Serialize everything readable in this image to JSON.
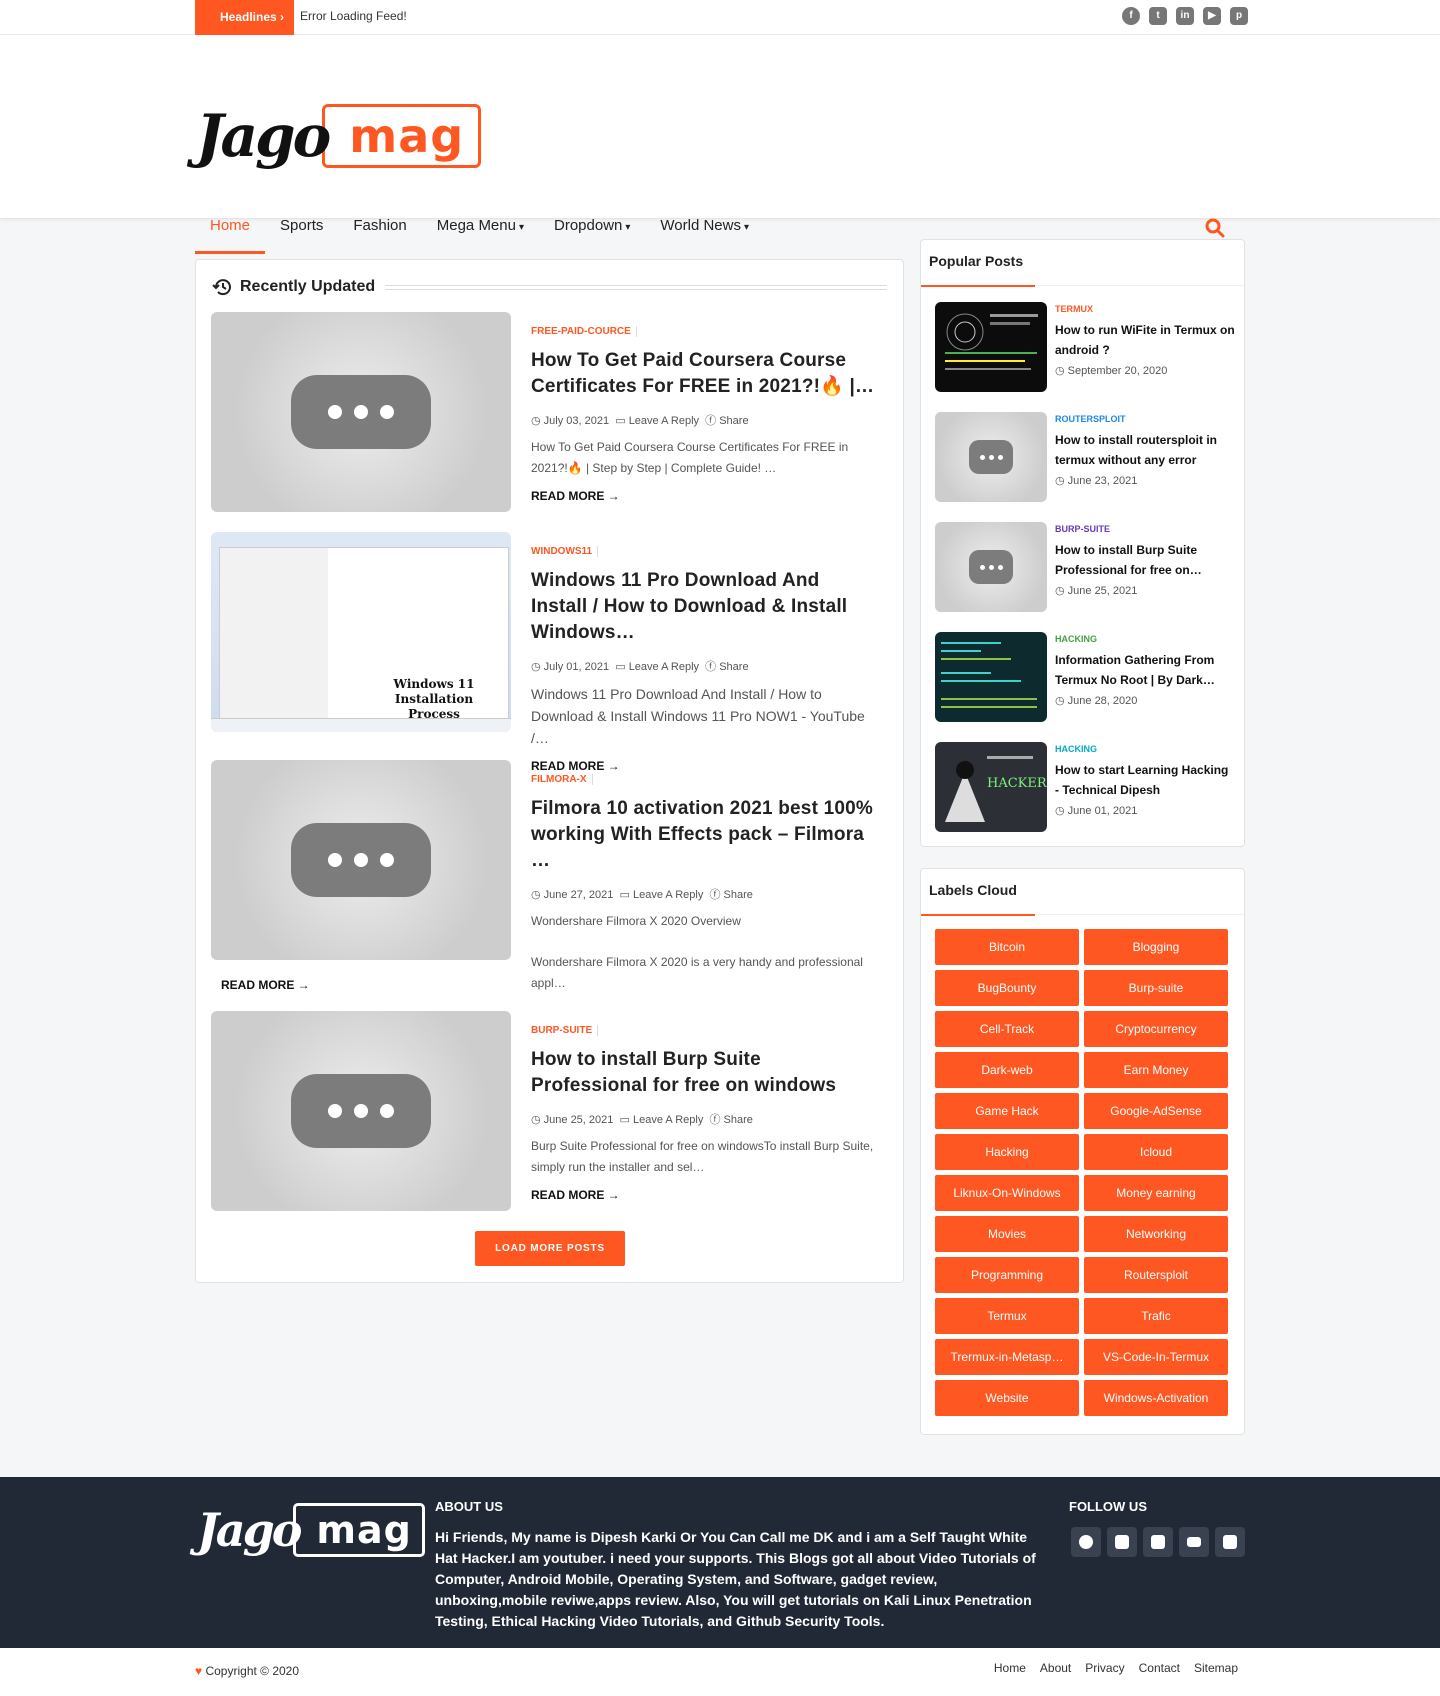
{
  "topbar": {
    "headlines_label": "Headlines",
    "ticker_text": "Error Loading Feed!",
    "social_icons": [
      "facebook-icon",
      "twitter-icon",
      "linkedin-icon",
      "youtube-icon",
      "pinterest-icon"
    ]
  },
  "brand": {
    "logo_part1": "Jago",
    "logo_part2": "mag",
    "accent": "#fe5722"
  },
  "nav": {
    "items": [
      {
        "label": "Home",
        "active": true,
        "dropdown": false
      },
      {
        "label": "Sports",
        "active": false,
        "dropdown": false
      },
      {
        "label": "Fashion",
        "active": false,
        "dropdown": false
      },
      {
        "label": "Mega Menu",
        "active": false,
        "dropdown": true
      },
      {
        "label": "Dropdown",
        "active": false,
        "dropdown": true
      },
      {
        "label": "World News",
        "active": false,
        "dropdown": true
      }
    ],
    "caret": "❯"
  },
  "main": {
    "section_title": "Recently Updated",
    "posts": [
      {
        "category": "FREE-PAID-COURCE",
        "title": "How To Get Paid Coursera Course Certificates For FREE in 2021?!🔥 |…",
        "date": "July 03, 2021",
        "reply": "Leave A Reply",
        "share": "Share",
        "excerpt": "How To Get Paid Coursera Course Certificates For FREE in 2021?!🔥 | Step by Step | Complete Guide! …",
        "read_more": "READ MORE"
      },
      {
        "category": "WINDOWS11",
        "title": "Windows 11 Pro Download And Install / How to Download & Install Windows…",
        "date": "July 01, 2021",
        "reply": "Leave A Reply",
        "share": "Share",
        "excerpt": "Windows 11 Pro Download And Install / How to Download & Install Windows 11 Pro NOW1 - YouTube /…",
        "read_more": "READ MORE",
        "thumb_text": "Windows 11 Installation Process"
      },
      {
        "category": "FILMORA-X",
        "title": "Filmora 10 activation 2021 best 100% working With Effects pack – Filmora …",
        "date": "June 27, 2021",
        "reply": "Leave A Reply",
        "share": "Share",
        "excerpt": "Wondershare Filmora X 2020 Overview",
        "excerpt2": "Wondershare Filmora X 2020 is a very handy and professional appl…",
        "read_more": "READ MORE"
      },
      {
        "category": "BURP-SUITE",
        "title": "How to install Burp Suite Professional for free on windows",
        "date": "June 25, 2021",
        "reply": "Leave A Reply",
        "share": "Share",
        "excerpt": "Burp Suite Professional for free on windowsTo install Burp Suite, simply run the installer and sel…",
        "read_more": "READ MORE"
      }
    ],
    "load_more": "LOAD MORE POSTS"
  },
  "popular": {
    "title": "Popular Posts",
    "items": [
      {
        "category": "TERMUX",
        "color": "#fe5722",
        "title": "How to run WiFite in Termux on android ?",
        "date": "September 20, 2020"
      },
      {
        "category": "ROUTERSPLOIT",
        "color": "#1e88e5",
        "title": "How to install routersploit in termux without any error",
        "date": "June 23, 2021"
      },
      {
        "category": "BURP-SUITE",
        "color": "#673ab7",
        "title": "How to install Burp Suite Professional for free on…",
        "date": "June 25, 2021"
      },
      {
        "category": "HACKING",
        "color": "#43a047",
        "title": "Information Gathering From Termux No Root | By Dark…",
        "date": "June 28, 2020"
      },
      {
        "category": "HACKING",
        "color": "#00acc1",
        "title": "How to start Learning Hacking - Technical Dipesh",
        "date": "June 01, 2021"
      }
    ]
  },
  "labels_cloud": {
    "title": "Labels Cloud",
    "items": [
      "Bitcoin",
      "Blogging",
      "BugBounty",
      "Burp-suite",
      "Cell-Track",
      "Cryptocurrency",
      "Dark-web",
      "Earn Money",
      "Game Hack",
      "Google-AdSense",
      "Hacking",
      "Icloud",
      "Liknux-On-Windows",
      "Money earning",
      "Movies",
      "Networking",
      "Programming",
      "Routersploit",
      "Termux",
      "Trafic",
      "Trermux-in-Metasp…",
      "VS-Code-In-Termux",
      "Website",
      "Windows-Activation"
    ]
  },
  "footer": {
    "about_title": "ABOUT US",
    "about_text": "Hi Friends, My name is Dipesh Karki Or You Can Call me DK and i am a Self Taught White Hat Hacker.I am youtuber. i need your supports. This Blogs got all about Video Tutorials of Computer, Android Mobile, Operating System, and Software, gadget review, unboxing,mobile reviwe,apps review. Also, You will get tutorials on Kali Linux Penetration Testing, Ethical Hacking Video Tutorials, and Github Security Tools.",
    "follow_title": "FOLLOW US",
    "copyright": "Copyright © 2020",
    "links": [
      "Home",
      "About",
      "Privacy",
      "Contact",
      "Sitemap"
    ]
  }
}
